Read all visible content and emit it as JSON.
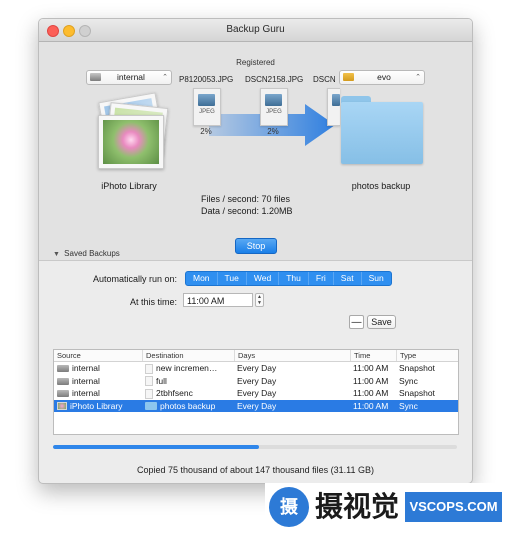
{
  "window": {
    "title": "Backup Guru"
  },
  "top": {
    "registered": "Registered",
    "source_popup": "internal",
    "dest_popup": "evo",
    "source_label": "iPhoto Library",
    "dest_label": "photos backup",
    "files": [
      {
        "name": "P8120053.JPG",
        "type": "JPEG",
        "percent": "2%"
      },
      {
        "name": "DSCN2158.JPG",
        "type": "JPEG",
        "percent": "2%"
      },
      {
        "name": "DSCN",
        "type": "",
        "percent": ""
      }
    ],
    "stats_files": "Files / second: 70 files",
    "stats_data": "Data / second: 1.20MB",
    "stop_label": "Stop"
  },
  "saved": {
    "header": "Saved Backups",
    "auto_label": "Automatically run on:",
    "days": [
      "Mon",
      "Tue",
      "Wed",
      "Thu",
      "Fri",
      "Sat",
      "Sun"
    ],
    "time_label": "At this time:",
    "time_value": "11:00 AM",
    "minus_label": "—",
    "save_label": "Save"
  },
  "table": {
    "columns": [
      "Source",
      "Destination",
      "Days",
      "Time",
      "Type"
    ],
    "rows": [
      {
        "source": "internal",
        "destination": "new incremen…",
        "days": "Every Day",
        "time": "11:00 AM",
        "type": "Snapshot"
      },
      {
        "source": "internal",
        "destination": "full",
        "days": "Every Day",
        "time": "11:00 AM",
        "type": "Sync"
      },
      {
        "source": "internal",
        "destination": "2tbhfsenc",
        "days": "Every Day",
        "time": "11:00 AM",
        "type": "Snapshot"
      },
      {
        "source": "iPhoto Library",
        "destination": "photos backup",
        "days": "Every Day",
        "time": "11:00 AM",
        "type": "Sync",
        "selected": true
      }
    ]
  },
  "progress": {
    "fraction": 0.51
  },
  "status": "Copied 75 thousand of about 147 thousand files (31.11 GB)",
  "watermark": {
    "icon": "摄",
    "text": "摄视觉",
    "site": "VSCOPS.COM"
  },
  "colors": {
    "accent": "#2f86ea",
    "selection": "#2a7be4",
    "stop": "#1a7fe8"
  }
}
